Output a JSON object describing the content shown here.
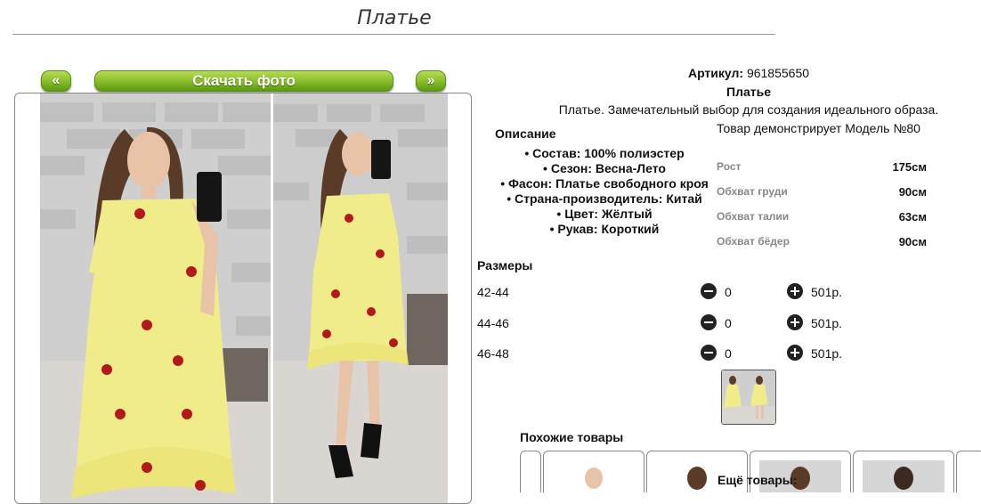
{
  "header": {
    "title": "Платье"
  },
  "gallery": {
    "prev_label": "«",
    "next_label": "»",
    "download_label": "Скачать фото"
  },
  "product": {
    "article_label": "Артикул:",
    "article_value": "961855650",
    "name": "Платье",
    "description": "Платье. Замечательный выбор для создания идеального образа.",
    "model_line": "Товар демонстрирует Модель №80"
  },
  "details": {
    "heading": "Описание",
    "items": [
      "Состав: 100% полиэстер",
      "Сезон: Весна-Лето",
      "Фасон: Платье свободного кроя",
      "Страна-производитель: Китай",
      "Цвет: Жёлтый",
      "Рукав: Короткий"
    ]
  },
  "model_measurements": [
    {
      "label": "Рост",
      "value": "175см"
    },
    {
      "label": "Обхват груди",
      "value": "90см"
    },
    {
      "label": "Обхват талии",
      "value": "63см"
    },
    {
      "label": "Обхват бёдер",
      "value": "90см"
    }
  ],
  "sizes": {
    "heading": "Размеры",
    "rows": [
      {
        "size": "42-44",
        "qty": "0",
        "price": "501р."
      },
      {
        "size": "44-46",
        "qty": "0",
        "price": "501р."
      },
      {
        "size": "46-48",
        "qty": "0",
        "price": "501р."
      }
    ]
  },
  "similar": {
    "heading": "Похожие товары"
  },
  "more": {
    "heading": "Ещё товары:"
  },
  "colors": {
    "button_green": "#8fc12e",
    "dress_yellow": "#f1ec8a",
    "rose_red": "#b2191c"
  }
}
